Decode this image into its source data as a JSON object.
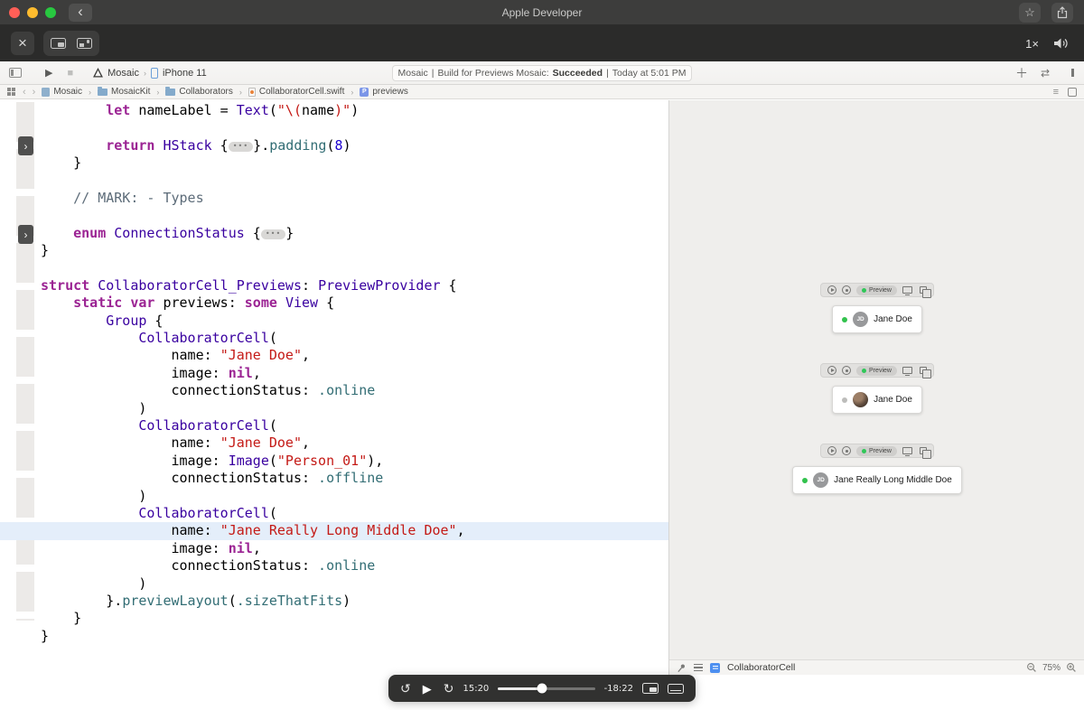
{
  "window": {
    "title": "Apple Developer"
  },
  "chrome": {
    "speed": "1×"
  },
  "xcode": {
    "toolbar": {
      "scheme": "Mosaic",
      "device": "iPhone 11",
      "status": {
        "app": "Mosaic",
        "sep": "|",
        "msg": "Build for Previews Mosaic:",
        "result": "Succeeded",
        "time": "Today at 5:01 PM"
      }
    },
    "breadcrumbs": {
      "items": [
        "Mosaic",
        "MosaicKit",
        "Collaborators",
        "CollaboratorCell.swift",
        "previews"
      ]
    },
    "editor": {
      "lines": [
        {
          "s": [
            [
              "",
              "        "
            ],
            [
              "kw",
              "let"
            ],
            [
              "",
              " nameLabel = "
            ],
            [
              "type",
              "Text"
            ],
            [
              "",
              "("
            ],
            [
              "str",
              "\"\\("
            ],
            [
              "",
              "name"
            ],
            [
              "str",
              ")\""
            ],
            [
              "",
              ")"
            ]
          ]
        },
        {
          "s": [
            [
              "",
              ""
            ]
          ]
        },
        {
          "s": [
            [
              "",
              "        "
            ],
            [
              "kw",
              "return"
            ],
            [
              "",
              " "
            ],
            [
              "type",
              "HStack"
            ],
            [
              "",
              " {"
            ],
            [
              "fold",
              "•••"
            ],
            [
              "",
              "}."
            ],
            [
              "fn",
              "padding"
            ],
            [
              "",
              "("
            ],
            [
              "num",
              "8"
            ],
            [
              "",
              ")"
            ]
          ]
        },
        {
          "s": [
            [
              "",
              "    }"
            ]
          ]
        },
        {
          "s": [
            [
              "",
              ""
            ]
          ]
        },
        {
          "s": [
            [
              "",
              "    "
            ],
            [
              "cmt",
              "// MARK: - Types"
            ]
          ]
        },
        {
          "s": [
            [
              "",
              ""
            ]
          ]
        },
        {
          "s": [
            [
              "",
              "    "
            ],
            [
              "kw",
              "enum"
            ],
            [
              "",
              " "
            ],
            [
              "type",
              "ConnectionStatus"
            ],
            [
              "",
              " {"
            ],
            [
              "fold",
              "•••"
            ],
            [
              "",
              "}"
            ]
          ]
        },
        {
          "s": [
            [
              "",
              "}"
            ]
          ]
        },
        {
          "s": [
            [
              "",
              ""
            ]
          ]
        },
        {
          "s": [
            [
              "kw",
              "struct"
            ],
            [
              "",
              " "
            ],
            [
              "type",
              "CollaboratorCell_Previews"
            ],
            [
              "",
              ": "
            ],
            [
              "type",
              "PreviewProvider"
            ],
            [
              "",
              " {"
            ]
          ]
        },
        {
          "s": [
            [
              "",
              "    "
            ],
            [
              "kw",
              "static"
            ],
            [
              "",
              " "
            ],
            [
              "kw",
              "var"
            ],
            [
              "",
              " previews: "
            ],
            [
              "kw",
              "some"
            ],
            [
              "",
              " "
            ],
            [
              "type",
              "View"
            ],
            [
              "",
              " {"
            ]
          ]
        },
        {
          "s": [
            [
              "",
              "        "
            ],
            [
              "type",
              "Group"
            ],
            [
              "",
              " {"
            ]
          ]
        },
        {
          "s": [
            [
              "",
              "            "
            ],
            [
              "type",
              "CollaboratorCell"
            ],
            [
              "",
              "("
            ]
          ]
        },
        {
          "s": [
            [
              "",
              "                name: "
            ],
            [
              "str",
              "\"Jane Doe\""
            ],
            [
              "",
              ","
            ]
          ]
        },
        {
          "s": [
            [
              "",
              "                image: "
            ],
            [
              "kw",
              "nil"
            ],
            [
              "",
              ","
            ]
          ]
        },
        {
          "s": [
            [
              "",
              "                connectionStatus: "
            ],
            [
              "fn",
              ".online"
            ]
          ]
        },
        {
          "s": [
            [
              "",
              "            )"
            ]
          ]
        },
        {
          "s": [
            [
              "",
              "            "
            ],
            [
              "type",
              "CollaboratorCell"
            ],
            [
              "",
              "("
            ]
          ]
        },
        {
          "s": [
            [
              "",
              "                name: "
            ],
            [
              "str",
              "\"Jane Doe\""
            ],
            [
              "",
              ","
            ]
          ]
        },
        {
          "s": [
            [
              "",
              "                image: "
            ],
            [
              "type",
              "Image"
            ],
            [
              "",
              "("
            ],
            [
              "str",
              "\"Person_01\""
            ],
            [
              "",
              "),"
            ]
          ]
        },
        {
          "s": [
            [
              "",
              "                connectionStatus: "
            ],
            [
              "fn",
              ".offline"
            ]
          ]
        },
        {
          "s": [
            [
              "",
              "            )"
            ]
          ]
        },
        {
          "s": [
            [
              "",
              "            "
            ],
            [
              "type",
              "CollaboratorCell"
            ],
            [
              "",
              "("
            ]
          ]
        },
        {
          "hl": true,
          "s": [
            [
              "",
              "                name: "
            ],
            [
              "str",
              "\"Jane Really Long Middle Doe\""
            ],
            [
              "",
              ","
            ]
          ]
        },
        {
          "s": [
            [
              "",
              "                image: "
            ],
            [
              "kw",
              "nil"
            ],
            [
              "",
              ","
            ]
          ]
        },
        {
          "s": [
            [
              "",
              "                connectionStatus: "
            ],
            [
              "fn",
              ".online"
            ]
          ]
        },
        {
          "s": [
            [
              "",
              "            )"
            ]
          ]
        },
        {
          "s": [
            [
              "",
              "        }."
            ],
            [
              "fn",
              "previewLayout"
            ],
            [
              "",
              "("
            ],
            [
              "fn",
              ".sizeThatFits"
            ],
            [
              "",
              ")"
            ]
          ]
        },
        {
          "s": [
            [
              "",
              "    }"
            ]
          ]
        },
        {
          "s": [
            [
              "",
              "}"
            ]
          ]
        }
      ]
    },
    "canvas": {
      "previews": [
        {
          "label": "Preview",
          "name": "Jane Doe",
          "avatar": "JD",
          "status": "online",
          "avatar_type": "initials"
        },
        {
          "label": "Preview",
          "name": "Jane Doe",
          "avatar": "",
          "status": "offline",
          "avatar_type": "photo"
        },
        {
          "label": "Preview",
          "name": "Jane Really Long Middle Doe",
          "avatar": "JD",
          "status": "online",
          "avatar_type": "initials"
        }
      ],
      "bottom": {
        "file": "CollaboratorCell",
        "zoom": "75%"
      }
    }
  },
  "player": {
    "elapsed": "15:20",
    "remaining": "-18:22",
    "progress": 0.455
  }
}
